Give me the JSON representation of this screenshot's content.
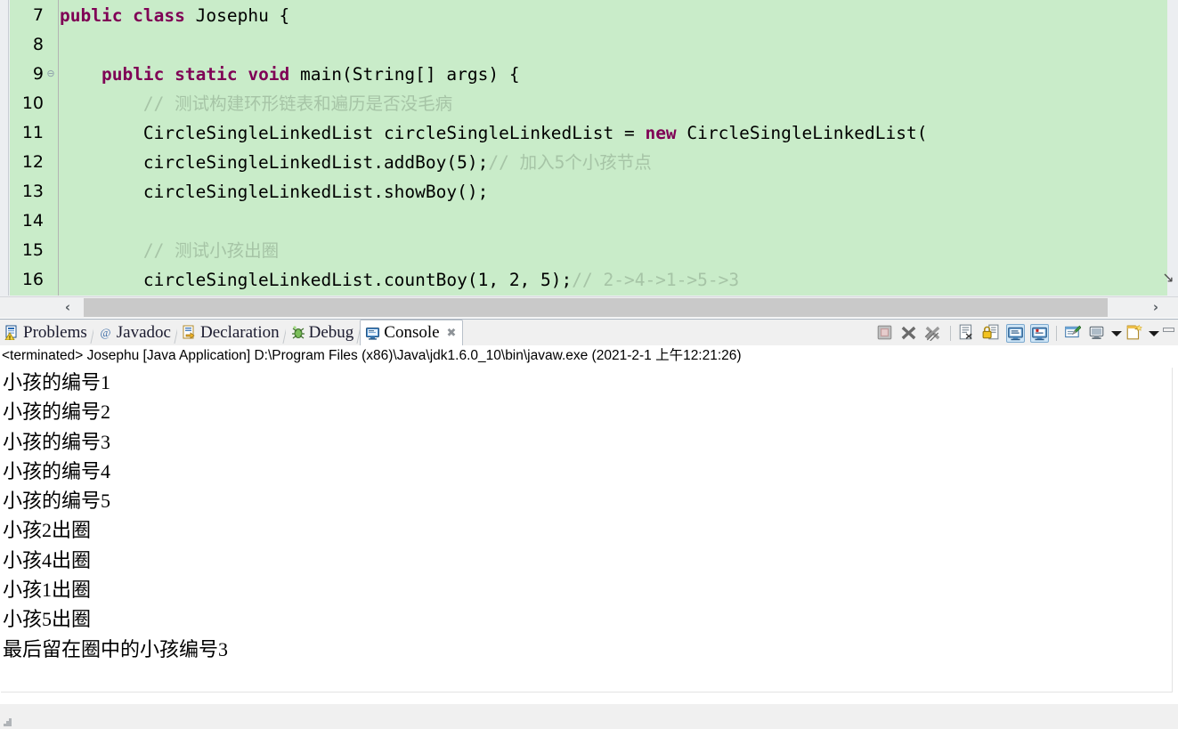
{
  "editor": {
    "background_color": "#c9ecc9",
    "keyword_color": "#7f0055",
    "comment_color": "#a6c4a6",
    "fold_marker": "⊖",
    "scroll_down_icon": "↘",
    "lines": [
      {
        "number": "7",
        "folded": false,
        "indent": 0,
        "tokens": [
          {
            "t": "kw",
            "s": "public class "
          },
          {
            "t": "plain",
            "s": "Josephu {"
          }
        ]
      },
      {
        "number": "8",
        "folded": false,
        "indent": 0,
        "tokens": []
      },
      {
        "number": "9",
        "folded": true,
        "indent": 0,
        "tokens": [
          {
            "t": "plain",
            "s": "    "
          },
          {
            "t": "kw",
            "s": "public static void "
          },
          {
            "t": "plain",
            "s": "main(String[] args) {"
          }
        ]
      },
      {
        "number": "10",
        "folded": false,
        "indent": 0,
        "tokens": [
          {
            "t": "plain",
            "s": "        "
          },
          {
            "t": "cmt",
            "s": "// 测试构建环形链表和遍历是否没毛病"
          }
        ]
      },
      {
        "number": "11",
        "folded": false,
        "indent": 0,
        "tokens": [
          {
            "t": "plain",
            "s": "        CircleSingleLinkedList circleSingleLinkedList = "
          },
          {
            "t": "kw",
            "s": "new "
          },
          {
            "t": "plain",
            "s": "CircleSingleLinkedList("
          }
        ]
      },
      {
        "number": "12",
        "folded": false,
        "indent": 0,
        "tokens": [
          {
            "t": "plain",
            "s": "        circleSingleLinkedList.addBoy(5);"
          },
          {
            "t": "cmt",
            "s": "// 加入5个小孩节点"
          }
        ]
      },
      {
        "number": "13",
        "folded": false,
        "indent": 0,
        "tokens": [
          {
            "t": "plain",
            "s": "        circleSingleLinkedList.showBoy();"
          }
        ]
      },
      {
        "number": "14",
        "folded": false,
        "indent": 0,
        "tokens": []
      },
      {
        "number": "15",
        "folded": false,
        "indent": 0,
        "tokens": [
          {
            "t": "plain",
            "s": "        "
          },
          {
            "t": "cmt",
            "s": "// 测试小孩出圈"
          }
        ]
      },
      {
        "number": "16",
        "folded": false,
        "indent": 0,
        "tokens": [
          {
            "t": "plain",
            "s": "        circleSingleLinkedList.countBoy(1, 2, 5);"
          },
          {
            "t": "cmt",
            "s": "// 2->4->1->5->3"
          }
        ]
      }
    ]
  },
  "hscroll": {
    "left_arrow": "‹",
    "right_arrow": "›"
  },
  "tabs": [
    {
      "id": "problems",
      "label": "Problems",
      "icon": "problems-icon",
      "active": false,
      "closable": false
    },
    {
      "id": "javadoc",
      "label": "Javadoc",
      "icon": "javadoc-icon",
      "active": false,
      "closable": false
    },
    {
      "id": "declaration",
      "label": "Declaration",
      "icon": "declaration-icon",
      "active": false,
      "closable": false
    },
    {
      "id": "debug",
      "label": "Debug",
      "icon": "debug-icon",
      "active": false,
      "closable": false
    },
    {
      "id": "console",
      "label": "Console",
      "icon": "console-icon",
      "active": true,
      "closable": true,
      "close_glyph": "✖"
    }
  ],
  "console_toolbar": [
    {
      "id": "terminate",
      "icon": "terminate-icon",
      "enabled": false,
      "toggled": false
    },
    {
      "id": "remove-launch",
      "icon": "remove-launch-icon",
      "enabled": true,
      "toggled": false
    },
    {
      "id": "remove-all-launches",
      "icon": "remove-all-launches-icon",
      "enabled": true,
      "toggled": false
    },
    {
      "id": "sep1",
      "icon": "separator",
      "enabled": false,
      "toggled": false
    },
    {
      "id": "clear-console",
      "icon": "clear-console-icon",
      "enabled": true,
      "toggled": false
    },
    {
      "id": "scroll-lock",
      "icon": "scroll-lock-icon",
      "enabled": true,
      "toggled": false
    },
    {
      "id": "show-console-on-output",
      "icon": "show-console-stdout-icon",
      "enabled": true,
      "toggled": true
    },
    {
      "id": "show-console-on-error",
      "icon": "show-console-stderr-icon",
      "enabled": true,
      "toggled": true
    },
    {
      "id": "sep2",
      "icon": "separator",
      "enabled": false,
      "toggled": false
    },
    {
      "id": "pin-console",
      "icon": "pin-console-icon",
      "enabled": true,
      "toggled": false
    },
    {
      "id": "display-console",
      "icon": "display-console-icon",
      "enabled": true,
      "toggled": false
    },
    {
      "id": "display-console-menu",
      "icon": "chevron-down-icon",
      "enabled": true,
      "toggled": false
    },
    {
      "id": "open-console",
      "icon": "open-console-icon",
      "enabled": true,
      "toggled": false
    },
    {
      "id": "open-console-menu",
      "icon": "chevron-down-icon",
      "enabled": true,
      "toggled": false
    },
    {
      "id": "minimize-view",
      "icon": "minimize-icon",
      "enabled": true,
      "toggled": false
    }
  ],
  "console": {
    "status_line": "<terminated> Josephu [Java Application] D:\\Program Files (x86)\\Java\\jdk1.6.0_10\\bin\\javaw.exe (2021-2-1 上午12:21:26)",
    "output": [
      "小孩的编号1",
      "小孩的编号2",
      "小孩的编号3",
      "小孩的编号4",
      "小孩的编号5",
      "小孩2出圈",
      "小孩4出圈",
      "小孩1出圈",
      "小孩5出圈",
      "最后留在圈中的小孩编号3"
    ]
  }
}
